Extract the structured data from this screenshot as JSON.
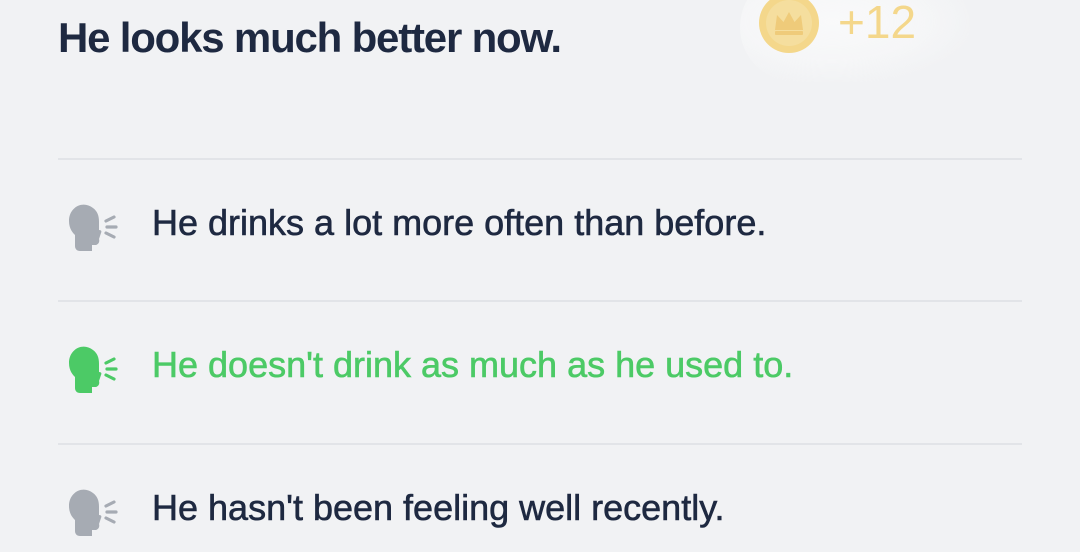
{
  "question": {
    "text": "He looks much better now."
  },
  "reward": {
    "icon": "crown-coin-icon",
    "count": "+12",
    "color": "#f6c84c"
  },
  "options": [
    {
      "text": "He drinks a lot more often than before.",
      "icon": "speaking-head-icon",
      "state": "default",
      "color": "#a6abb3"
    },
    {
      "text": "He doesn't drink as much as he used to.",
      "icon": "speaking-head-icon",
      "state": "correct",
      "color": "#4cca66"
    },
    {
      "text": "He hasn't been feeling well recently.",
      "icon": "speaking-head-icon",
      "state": "default",
      "color": "#a6abb3"
    }
  ],
  "colors": {
    "background": "#f1f2f4",
    "text": "#1e2941",
    "divider": "#e2e4e8",
    "correct": "#4cca66"
  }
}
